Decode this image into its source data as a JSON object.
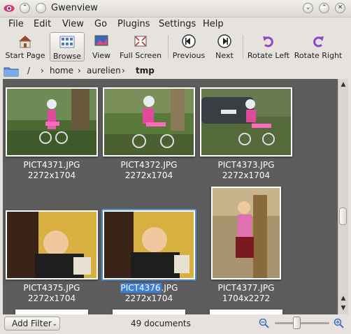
{
  "window": {
    "title": "Gwenview"
  },
  "menu": [
    "File",
    "Edit",
    "View",
    "Go",
    "Plugins",
    "Settings",
    "Help"
  ],
  "toolbar": {
    "start_page": "Start Page",
    "browse": "Browse",
    "view": "View",
    "full_screen": "Full Screen",
    "previous": "Previous",
    "next": "Next",
    "rotate_left": "Rotate Left",
    "rotate_right": "Rotate Right"
  },
  "breadcrumb": {
    "root": "/",
    "parts": [
      "home",
      "aurelien",
      "tmp"
    ]
  },
  "thumbnails": [
    {
      "name": "PICT4371.JPG",
      "size": "2272x1704"
    },
    {
      "name": "PICT4372.JPG",
      "size": "2272x1704"
    },
    {
      "name": "PICT4373.JPG",
      "size": "2272x1704"
    },
    {
      "name": "PICT4375.JPG",
      "size": "2272x1704"
    },
    {
      "name": "PICT4376.JPG",
      "name_highlight": "PICT4376",
      "name_rest": ".JPG",
      "size": "2272x1704",
      "selected": true
    },
    {
      "name": "PICT4377.JPG",
      "size": "1704x2272"
    }
  ],
  "status": {
    "add_filter": "Add Filter",
    "document_count": "49 documents",
    "zoom_level": 0.33
  },
  "icons": {
    "app": "gwenview-eye-icon",
    "zoom_out": "zoom-out-icon",
    "zoom_in": "zoom-in-icon",
    "folder": "folder-icon"
  },
  "colors": {
    "viewer_bg": "#5d5d5d",
    "selection": "#5aa0e8",
    "zoom_icon": "#3f73c4"
  }
}
